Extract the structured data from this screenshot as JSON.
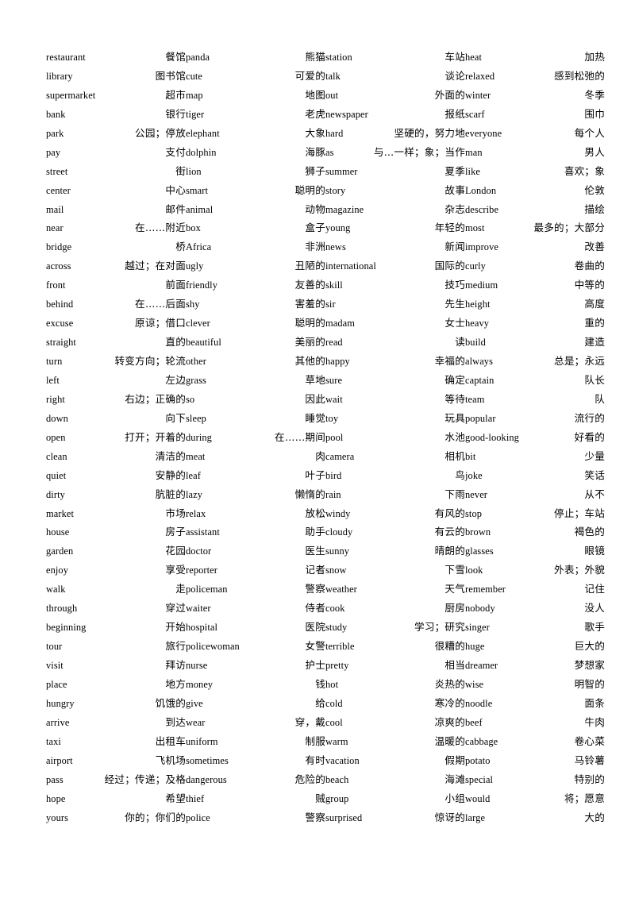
{
  "document": {
    "title": "English-Chinese Vocabulary List",
    "page_background": "#ffffff",
    "text_color": "#000000",
    "column_count": 4,
    "rows_per_column": 41
  },
  "columns": [
    {
      "index": 0,
      "entries": [
        {
          "term": "restaurant",
          "gloss": "餐馆"
        },
        {
          "term": "library",
          "gloss": "图书馆"
        },
        {
          "term": "supermarket",
          "gloss": "超市"
        },
        {
          "term": "bank",
          "gloss": "银行"
        },
        {
          "term": "park",
          "gloss": "公园；停放"
        },
        {
          "term": "pay",
          "gloss": "支付"
        },
        {
          "term": "street",
          "gloss": "街"
        },
        {
          "term": "center",
          "gloss": "中心"
        },
        {
          "term": "mail",
          "gloss": "邮件"
        },
        {
          "term": "near",
          "gloss": "在……附近"
        },
        {
          "term": "bridge",
          "gloss": "桥"
        },
        {
          "term": "across",
          "gloss": "越过；在对面"
        },
        {
          "term": "front",
          "gloss": "前面"
        },
        {
          "term": "behind",
          "gloss": "在……后面"
        },
        {
          "term": "excuse",
          "gloss": "原谅；借口"
        },
        {
          "term": "straight",
          "gloss": "直的"
        },
        {
          "term": "turn",
          "gloss": "转变方向；轮流"
        },
        {
          "term": "left",
          "gloss": "左边"
        },
        {
          "term": "right",
          "gloss": "右边；正确的"
        },
        {
          "term": "down",
          "gloss": "向下"
        },
        {
          "term": "open",
          "gloss": "打开；开着的"
        },
        {
          "term": "clean",
          "gloss": "清洁的"
        },
        {
          "term": "quiet",
          "gloss": "安静的"
        },
        {
          "term": "dirty",
          "gloss": "肮脏的"
        },
        {
          "term": "market",
          "gloss": "市场"
        },
        {
          "term": "house",
          "gloss": "房子"
        },
        {
          "term": "garden",
          "gloss": "花园"
        },
        {
          "term": "enjoy",
          "gloss": "享受"
        },
        {
          "term": "walk",
          "gloss": "走"
        },
        {
          "term": "through",
          "gloss": "穿过"
        },
        {
          "term": "beginning",
          "gloss": "开始"
        },
        {
          "term": "tour",
          "gloss": "旅行"
        },
        {
          "term": "visit",
          "gloss": "拜访"
        },
        {
          "term": "place",
          "gloss": "地方"
        },
        {
          "term": "hungry",
          "gloss": "饥饿的"
        },
        {
          "term": "arrive",
          "gloss": "到达"
        },
        {
          "term": "taxi",
          "gloss": "出租车"
        },
        {
          "term": "airport",
          "gloss": "飞机场"
        },
        {
          "term": "pass",
          "gloss": "经过；传递；及格"
        },
        {
          "term": "hope",
          "gloss": "希望"
        },
        {
          "term": "yours",
          "gloss": "你的；你们的"
        }
      ]
    },
    {
      "index": 1,
      "entries": [
        {
          "term": "panda",
          "gloss": "熊猫"
        },
        {
          "term": "cute",
          "gloss": "可爱的"
        },
        {
          "term": "map",
          "gloss": "地图"
        },
        {
          "term": "tiger",
          "gloss": "老虎"
        },
        {
          "term": "elephant",
          "gloss": "大象"
        },
        {
          "term": "dolphin",
          "gloss": "海豚"
        },
        {
          "term": "lion",
          "gloss": "狮子"
        },
        {
          "term": "smart",
          "gloss": "聪明的"
        },
        {
          "term": "animal",
          "gloss": "动物"
        },
        {
          "term": "box",
          "gloss": "盒子"
        },
        {
          "term": "Africa",
          "gloss": "非洲"
        },
        {
          "term": "ugly",
          "gloss": "丑陋的"
        },
        {
          "term": "friendly",
          "gloss": "友善的"
        },
        {
          "term": "shy",
          "gloss": "害羞的"
        },
        {
          "term": "clever",
          "gloss": "聪明的"
        },
        {
          "term": "beautiful",
          "gloss": "美丽的"
        },
        {
          "term": "other",
          "gloss": "其他的"
        },
        {
          "term": "grass",
          "gloss": "草地"
        },
        {
          "term": "so",
          "gloss": "因此"
        },
        {
          "term": "sleep",
          "gloss": "睡觉"
        },
        {
          "term": "during",
          "gloss": "在……期间"
        },
        {
          "term": "meat",
          "gloss": "肉"
        },
        {
          "term": "leaf",
          "gloss": "叶子"
        },
        {
          "term": "lazy",
          "gloss": "懒惰的"
        },
        {
          "term": "relax",
          "gloss": "放松"
        },
        {
          "term": "assistant",
          "gloss": "助手"
        },
        {
          "term": "doctor",
          "gloss": "医生"
        },
        {
          "term": "reporter",
          "gloss": "记者"
        },
        {
          "term": "policeman",
          "gloss": "警察"
        },
        {
          "term": "waiter",
          "gloss": "侍者"
        },
        {
          "term": "hospital",
          "gloss": "医院"
        },
        {
          "term": "policewoman",
          "gloss": "女警"
        },
        {
          "term": "nurse",
          "gloss": "护士"
        },
        {
          "term": "money",
          "gloss": "钱"
        },
        {
          "term": "give",
          "gloss": "给"
        },
        {
          "term": "wear",
          "gloss": "穿，戴"
        },
        {
          "term": "uniform",
          "gloss": "制服"
        },
        {
          "term": "sometimes",
          "gloss": "有时"
        },
        {
          "term": "dangerous",
          "gloss": "危险的"
        },
        {
          "term": "thief",
          "gloss": "贼"
        },
        {
          "term": "police",
          "gloss": "警察"
        }
      ]
    },
    {
      "index": 2,
      "entries": [
        {
          "term": "station",
          "gloss": "车站"
        },
        {
          "term": "talk",
          "gloss": "谈论"
        },
        {
          "term": "out",
          "gloss": "外面的"
        },
        {
          "term": "newspaper",
          "gloss": "报纸"
        },
        {
          "term": "hard",
          "gloss": "坚硬的，努力地"
        },
        {
          "term": "as",
          "gloss": "与…一样；象；当作"
        },
        {
          "term": "summer",
          "gloss": "夏季"
        },
        {
          "term": "story",
          "gloss": "故事"
        },
        {
          "term": "magazine",
          "gloss": "杂志"
        },
        {
          "term": "young",
          "gloss": "年轻的"
        },
        {
          "term": "news",
          "gloss": "新闻"
        },
        {
          "term": "international",
          "gloss": "国际的"
        },
        {
          "term": "skill",
          "gloss": "技巧"
        },
        {
          "term": "sir",
          "gloss": "先生"
        },
        {
          "term": "madam",
          "gloss": "女士"
        },
        {
          "term": "read",
          "gloss": "读"
        },
        {
          "term": "happy",
          "gloss": "幸福的"
        },
        {
          "term": "sure",
          "gloss": "确定"
        },
        {
          "term": "wait",
          "gloss": "等待"
        },
        {
          "term": "toy",
          "gloss": "玩具"
        },
        {
          "term": "pool",
          "gloss": "水池"
        },
        {
          "term": "camera",
          "gloss": "相机"
        },
        {
          "term": "bird",
          "gloss": "鸟"
        },
        {
          "term": "rain",
          "gloss": "下雨"
        },
        {
          "term": "windy",
          "gloss": "有风的"
        },
        {
          "term": "cloudy",
          "gloss": "有云的"
        },
        {
          "term": "sunny",
          "gloss": "晴朗的"
        },
        {
          "term": "snow",
          "gloss": "下雪"
        },
        {
          "term": "weather",
          "gloss": "天气"
        },
        {
          "term": "cook",
          "gloss": "厨房"
        },
        {
          "term": "study",
          "gloss": "学习；研究"
        },
        {
          "term": "terrible",
          "gloss": "很糟的"
        },
        {
          "term": "pretty",
          "gloss": "相当"
        },
        {
          "term": "hot",
          "gloss": "炎热的"
        },
        {
          "term": "cold",
          "gloss": "寒冷的"
        },
        {
          "term": "cool",
          "gloss": "凉爽的"
        },
        {
          "term": "warm",
          "gloss": "温暖的"
        },
        {
          "term": "vacation",
          "gloss": "假期"
        },
        {
          "term": "beach",
          "gloss": "海滩"
        },
        {
          "term": "group",
          "gloss": "小组"
        },
        {
          "term": "surprised",
          "gloss": "惊讶的"
        }
      ]
    },
    {
      "index": 3,
      "entries": [
        {
          "term": "heat",
          "gloss": "加热"
        },
        {
          "term": "relaxed",
          "gloss": "感到松弛的"
        },
        {
          "term": "winter",
          "gloss": "冬季"
        },
        {
          "term": "scarf",
          "gloss": "围巾"
        },
        {
          "term": "everyone",
          "gloss": "每个人"
        },
        {
          "term": "man",
          "gloss": "男人"
        },
        {
          "term": "like",
          "gloss": "喜欢；象"
        },
        {
          "term": "London",
          "gloss": "伦敦"
        },
        {
          "term": "describe",
          "gloss": "描绘"
        },
        {
          "term": "most",
          "gloss": "最多的；大部分"
        },
        {
          "term": "improve",
          "gloss": "改善"
        },
        {
          "term": "curly",
          "gloss": "卷曲的"
        },
        {
          "term": "medium",
          "gloss": "中等的"
        },
        {
          "term": "height",
          "gloss": "高度"
        },
        {
          "term": "heavy",
          "gloss": "重的"
        },
        {
          "term": "build",
          "gloss": "建造"
        },
        {
          "term": "always",
          "gloss": "总是；永远"
        },
        {
          "term": "captain",
          "gloss": "队长"
        },
        {
          "term": "team",
          "gloss": "队"
        },
        {
          "term": "popular",
          "gloss": "流行的"
        },
        {
          "term": "good-looking",
          "gloss": "好看的"
        },
        {
          "term": "bit",
          "gloss": "少量"
        },
        {
          "term": "joke",
          "gloss": "笑话"
        },
        {
          "term": "never",
          "gloss": "从不"
        },
        {
          "term": "stop",
          "gloss": "停止；车站"
        },
        {
          "term": "brown",
          "gloss": "褐色的"
        },
        {
          "term": "glasses",
          "gloss": "眼镜"
        },
        {
          "term": "look",
          "gloss": "外表；外貌"
        },
        {
          "term": "remember",
          "gloss": "记住"
        },
        {
          "term": "nobody",
          "gloss": "没人"
        },
        {
          "term": "singer",
          "gloss": "歌手"
        },
        {
          "term": "huge",
          "gloss": "巨大的"
        },
        {
          "term": "dreamer",
          "gloss": "梦想家"
        },
        {
          "term": "wise",
          "gloss": "明智的"
        },
        {
          "term": "noodle",
          "gloss": "面条"
        },
        {
          "term": "beef",
          "gloss": "牛肉"
        },
        {
          "term": "cabbage",
          "gloss": "卷心菜"
        },
        {
          "term": "potato",
          "gloss": "马铃薯"
        },
        {
          "term": "special",
          "gloss": "特别的"
        },
        {
          "term": "would",
          "gloss": "将；愿意"
        },
        {
          "term": "large",
          "gloss": "大的"
        }
      ]
    }
  ]
}
